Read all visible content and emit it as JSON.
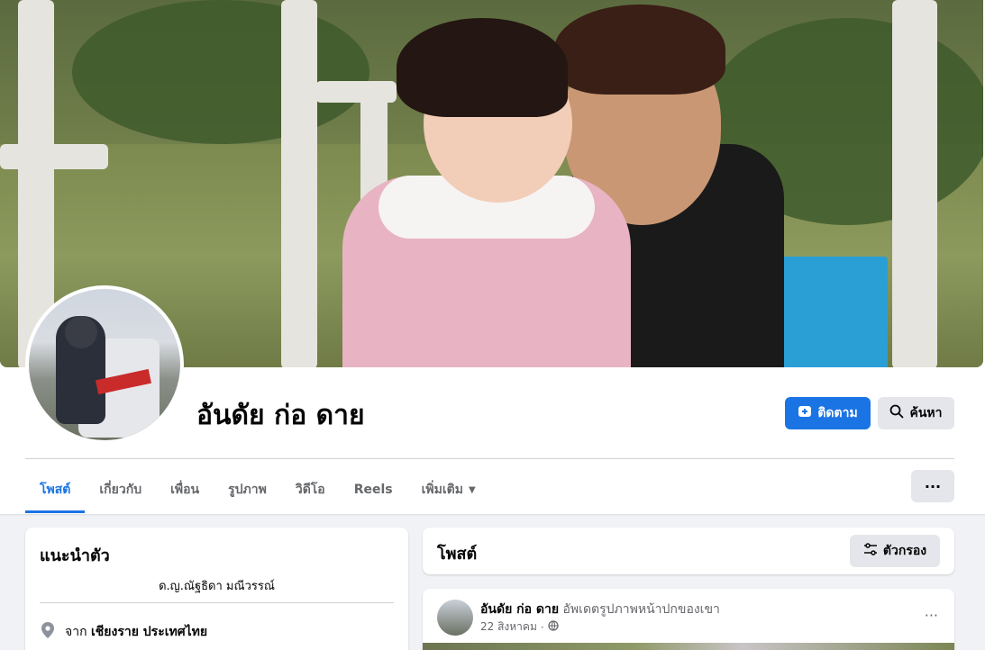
{
  "profile": {
    "name": "อันดัย ก่อ ดาย"
  },
  "actions": {
    "follow_label": "ติดตาม",
    "search_label": "ค้นหา",
    "more_label": "···"
  },
  "tabs": [
    {
      "label": "โพสต์",
      "active": true
    },
    {
      "label": "เกี่ยวกับ",
      "active": false
    },
    {
      "label": "เพื่อน",
      "active": false
    },
    {
      "label": "รูปภาพ",
      "active": false
    },
    {
      "label": "วิดีโอ",
      "active": false
    },
    {
      "label": "Reels",
      "active": false
    },
    {
      "label": "เพิ่มเติม",
      "active": false
    }
  ],
  "intro": {
    "title": "แนะนำตัว",
    "bio": "ด.ญ.ณัฐธิดา มณีวรรณ์",
    "location_prefix": "จาก",
    "location": "เชียงราย ประเทศไทย"
  },
  "posts_section": {
    "title": "โพสต์",
    "filter_label": "ตัวกรอง"
  },
  "post": {
    "author": "อันดัย ก่อ ดาย",
    "action": "อัพเดตรูปภาพหน้าปกของเขา",
    "date": "22 สิงหาคม",
    "separator": "·",
    "more_label": "···"
  },
  "colors": {
    "accent": "#1b74e4",
    "secondary_button": "#e4e6eb",
    "background": "#f0f2f5"
  },
  "icons": {
    "follow": "follow-icon",
    "search": "search-icon",
    "filter": "filter-icon",
    "location": "location-pin-icon",
    "globe": "globe-icon",
    "caret": "caret-down-icon"
  }
}
